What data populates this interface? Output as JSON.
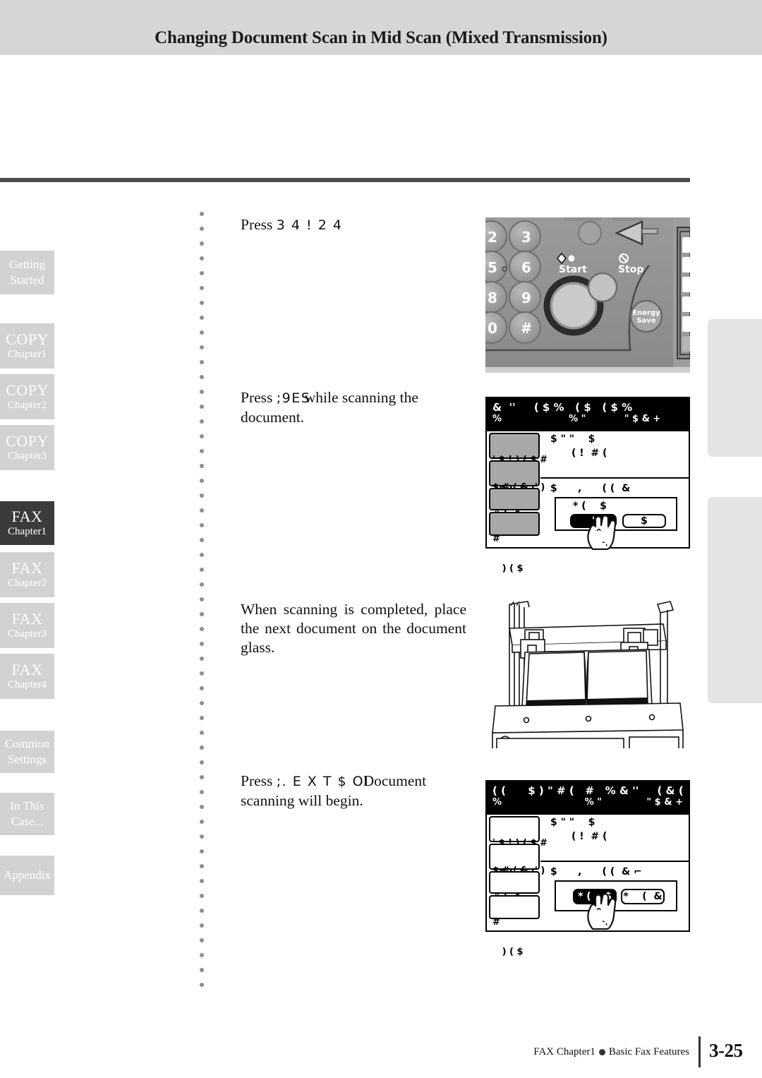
{
  "header": {
    "title": "Changing Document Scan in Mid Scan (Mixed Transmission)"
  },
  "steps": [
    {
      "id": "step-press-start",
      "lead": "Press",
      "garbled_key": "3 4 ! 2 4",
      "trail": "",
      "tail": ""
    },
    {
      "id": "step-press-while-scanning",
      "lead": "Press",
      "garbled_key": ";9ES",
      "trail": "while scanning the",
      "tail": "document."
    },
    {
      "id": "step-place-next-document",
      "text": "When scanning is completed, place the next document on the document glass."
    },
    {
      "id": "step-press-document-scanning",
      "lead": "Press",
      "garbled_key": ";. E X T  $ OI",
      "trail": "Document",
      "tail": "scanning will begin."
    }
  ],
  "control_panel": {
    "keys": [
      "2",
      "3",
      "5",
      "6",
      "8",
      "9",
      "0",
      "#"
    ],
    "start_label": "Start",
    "stop_label": "Stop",
    "energy_save_label": "Energy\nSave"
  },
  "lcd_screen_1": {
    "title_line1": "&  ''     ( $ %   ( $   ( $ %",
    "title_line2": "%                     % \"            \" $ & +",
    "side_buttons": [
      {
        "line1": "' $ ! ) ( $ #",
        "line2": "  $ & \"  !",
        "style": "gray"
      },
      {
        "line1": "$ # ( &  ' )",
        "line2": "  $ & \"  !",
        "style": "gray"
      },
      {
        "line1": "# !  &",
        "line2": "",
        "style": "gray"
      },
      {
        "line1": "#",
        "line2": "   ) ( $",
        "style": "gray"
      }
    ],
    "body_label_1": "$ \" \"    $",
    "body_label_2": "( !  # (",
    "prompt": "$      ,      ( (  &",
    "dialog_label": "* (    $",
    "btn_selected": "'",
    "btn_unselected": "$"
  },
  "lcd_screen_2": {
    "title_line1": "( (      $ ) \" # (   #   % & ''     ( & (",
    "title_line2": "%                          % \"              \" $ & +",
    "side_buttons": [
      {
        "line1": "' $ ! ) ( $ #",
        "line2": "  $ & \"  !",
        "style": "white"
      },
      {
        "line1": "$ # ( &  ' )",
        "line2": "  $ & \"  !",
        "style": "white"
      },
      {
        "line1": "# !  &",
        "line2": "",
        "style": "white"
      },
      {
        "line1": "#",
        "line2": "   ) ( $",
        "style": "white"
      }
    ],
    "body_label_1": "$ \" \"    $",
    "body_label_2": "( !  # (",
    "prompt": "$      ,      ( (  & ⌐",
    "btn_selected": "* (    $",
    "btn_unselected": "*    (  &"
  },
  "sidebar": {
    "tabs": [
      {
        "id": "tab-getting-started",
        "line1": "Getting",
        "line2": "Started",
        "style": "two-line",
        "active": false
      },
      {
        "id": "tab-copy-chapter1",
        "main": "COPY",
        "sub": "Chapter1",
        "style": "main-sub",
        "active": false
      },
      {
        "id": "tab-copy-chapter2",
        "main": "COPY",
        "sub": "Chapter2",
        "style": "main-sub",
        "active": false
      },
      {
        "id": "tab-copy-chapter3",
        "main": "COPY",
        "sub": "Chapter3",
        "style": "main-sub",
        "active": false
      },
      {
        "id": "tab-fax-chapter1",
        "main": "FAX",
        "sub": "Chapter1",
        "style": "main-sub",
        "active": true
      },
      {
        "id": "tab-fax-chapter2",
        "main": "FAX",
        "sub": "Chapter2",
        "style": "main-sub",
        "active": false
      },
      {
        "id": "tab-fax-chapter3",
        "main": "FAX",
        "sub": "Chapter3",
        "style": "main-sub",
        "active": false
      },
      {
        "id": "tab-fax-chapter4",
        "main": "FAX",
        "sub": "Chapter4",
        "style": "main-sub",
        "active": false
      },
      {
        "id": "tab-common-settings",
        "line1": "Common",
        "line2": "Settings",
        "style": "two-line",
        "active": false
      },
      {
        "id": "tab-in-this-case",
        "line1": "In This",
        "line2": "Case...",
        "style": "two-line",
        "active": false
      },
      {
        "id": "tab-appendix",
        "line1": "Appendix",
        "line2": "",
        "style": "two-line",
        "active": false
      }
    ]
  },
  "footer": {
    "left_text_a": "FAX Chapter1",
    "left_text_b": "Basic Fax Features",
    "page_number": "3-25"
  },
  "colors": {
    "header_band": "#d6d6d6",
    "tab_inactive": "#d2d2d2",
    "tab_active": "#3b3b3b",
    "rule": "#4a4a4a"
  }
}
